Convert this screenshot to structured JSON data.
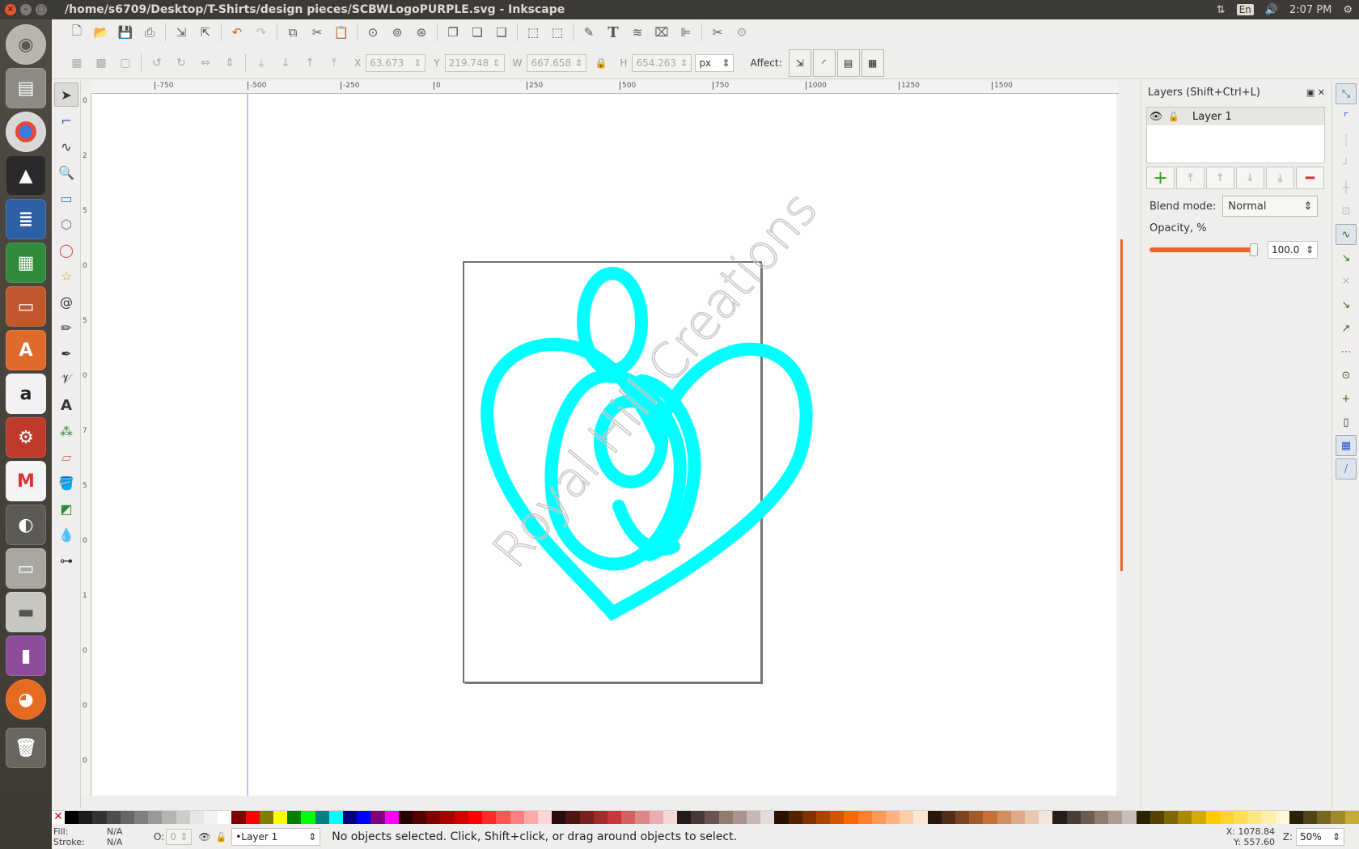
{
  "window": {
    "title": "/home/s6709/Desktop/T-Shirts/design pieces/SCBWLogoPURPLE.svg - Inkscape",
    "clock": "2:07 PM",
    "lang": "En"
  },
  "launcher": [
    "Ubuntu",
    "Files",
    "Chrome",
    "Inkscape",
    "Writer",
    "Calc",
    "Impress",
    "Software",
    "Amazon",
    "Settings",
    "Gmail",
    "GIMP",
    "Disk",
    "Scanner",
    "Videos",
    "Firefox",
    "Trash"
  ],
  "controls": {
    "x_label": "X",
    "x": "63.673",
    "y_label": "Y",
    "y": "219.748",
    "w_label": "W",
    "w": "667.658",
    "h_label": "H",
    "h": "654.263",
    "unit": "px",
    "affect_label": "Affect:"
  },
  "ruler": {
    "h_ticks": [
      "-750",
      "-500",
      "-250",
      "0",
      "250",
      "500",
      "750",
      "1000",
      "1250",
      "1500"
    ],
    "v_ticks": [
      "0",
      "2",
      "5",
      "0",
      "5",
      "0",
      "7",
      "5",
      "0",
      "1",
      "0",
      "0",
      "0"
    ]
  },
  "canvas": {
    "watermark": "Royal Hill Creations",
    "logo_color": "#00ffff",
    "watermark_color": "#c8c8c8"
  },
  "layers_panel": {
    "title": "Layers (Shift+Ctrl+L)",
    "layer_name": "Layer 1",
    "blend_label": "Blend mode:",
    "blend_value": "Normal",
    "opacity_label": "Opacity, %",
    "opacity_value": "100.0",
    "opacity_fraction": 1.0
  },
  "palette_colors": [
    "#000000",
    "#1a1a1a",
    "#333333",
    "#4d4d4d",
    "#666666",
    "#808080",
    "#999999",
    "#b3b3b3",
    "#cccccc",
    "#e6e6e6",
    "#f2f2f2",
    "#ffffff",
    "#800000",
    "#ff0000",
    "#808000",
    "#ffff00",
    "#008000",
    "#00ff00",
    "#008080",
    "#00ffff",
    "#000080",
    "#0000ff",
    "#800080",
    "#ff00ff",
    "#2b0000",
    "#550000",
    "#800000",
    "#aa0000",
    "#d40000",
    "#ff0000",
    "#ff2a2a",
    "#ff5555",
    "#ff8080",
    "#ffaaaa",
    "#ffd5d5",
    "#280b0b",
    "#501616",
    "#782121",
    "#a02c2c",
    "#c83737",
    "#d35f5f",
    "#de8787",
    "#e9afaf",
    "#f4d7d7",
    "#241c1c",
    "#483737",
    "#6c5353",
    "#917c6f",
    "#ac9393",
    "#c8b7b7",
    "#e3dbdb",
    "#2b1100",
    "#552200",
    "#803300",
    "#aa4400",
    "#d45500",
    "#ff6600",
    "#ff7f2a",
    "#ff9955",
    "#ffb380",
    "#ffccaa",
    "#ffe6d5",
    "#28170b",
    "#502d16",
    "#784421",
    "#a05a2c",
    "#c87137",
    "#d38d5f",
    "#deaa87",
    "#e9c6af",
    "#f4e3d7",
    "#241f1c",
    "#483e37",
    "#6c5d53",
    "#917c6f",
    "#ac9d93",
    "#c8beb7",
    "#2b2200",
    "#554400",
    "#806600",
    "#aa8800",
    "#d4aa00",
    "#ffcc00",
    "#ffd42a",
    "#ffdd55",
    "#ffe680",
    "#ffeeaa",
    "#fff6d5",
    "#28220b",
    "#504416",
    "#786721",
    "#a0892c",
    "#c8ab37"
  ],
  "status": {
    "fill_label": "Fill:",
    "fill": "N/A",
    "stroke_label": "Stroke:",
    "stroke": "N/A",
    "opacity_label": "O:",
    "opacity": "0",
    "layer": "•Layer 1",
    "message": "No objects selected. Click, Shift+click, or drag around objects to select.",
    "x_coord": "X: 1078.84",
    "y_coord": "Y:  557.60",
    "zoom_label": "Z:",
    "zoom": "50%"
  }
}
